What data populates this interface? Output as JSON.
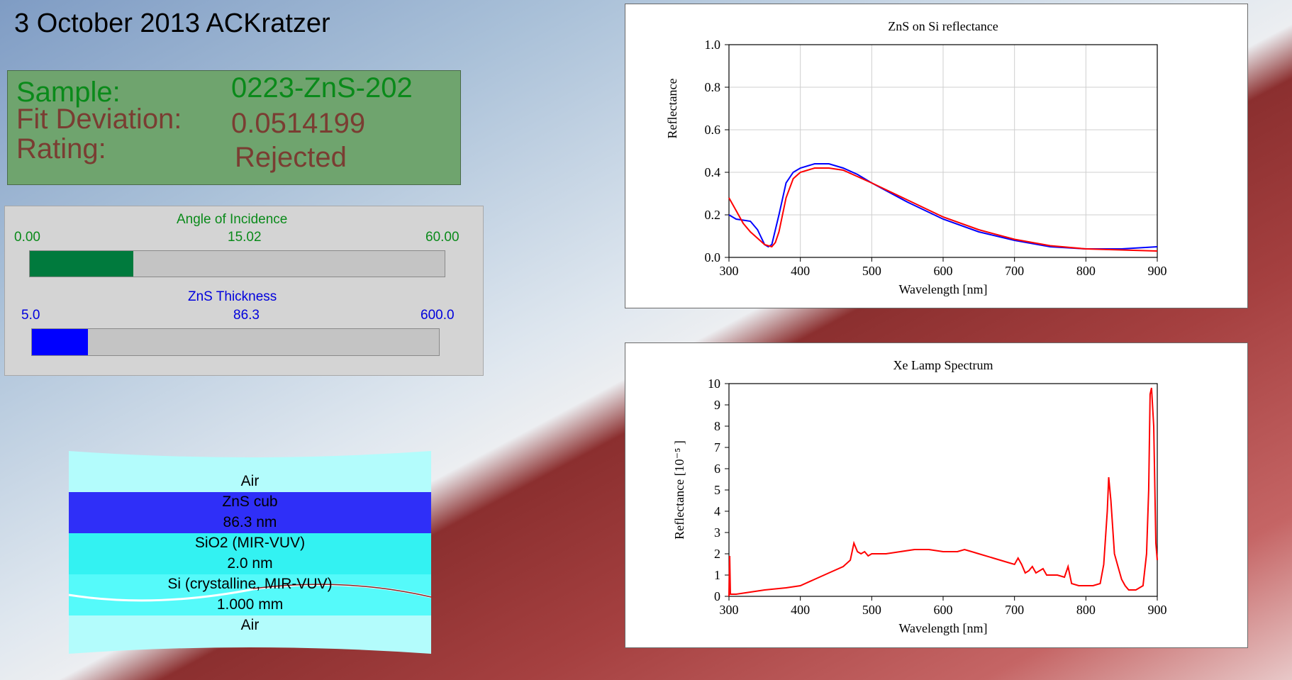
{
  "header": {
    "title": "3 October 2013 ACKratzer"
  },
  "info": {
    "sample_label": "Sample:",
    "sample_value": "0223-ZnS-202",
    "fit_label": "Fit Deviation:",
    "fit_value": "0.0514199",
    "rating_label": "Rating:",
    "rating_value": "Rejected"
  },
  "sliders": {
    "angle": {
      "title": "Angle of Incidence",
      "min": "0.00",
      "value": "15.02",
      "max": "60.00",
      "fraction": 0.25,
      "color": "#007a3d"
    },
    "thickness": {
      "title": "ZnS Thickness",
      "min": "5.0",
      "value": "86.3",
      "max": "600.0",
      "fraction": 0.137,
      "color": "#0000ff"
    }
  },
  "stack": {
    "layers": [
      {
        "label": "Air",
        "color": "#b3fcfc"
      },
      {
        "label": "ZnS cub",
        "sub": "86.3 nm",
        "color": "#2f2ff8"
      },
      {
        "label": "SiO2 (MIR-VUV)",
        "sub": "2.0 nm",
        "color": "#33f2f2"
      },
      {
        "label": "Si (crystalline, MIR-VUV)",
        "sub": "1.000 mm",
        "color": "#55fafa"
      },
      {
        "label": "Air",
        "color": "#b3fcfc"
      }
    ]
  },
  "chart_data": [
    {
      "type": "line",
      "title": "ZnS on Si reflectance",
      "xlabel": "Wavelength [nm]",
      "ylabel": "Reflectance",
      "xlim": [
        300,
        900
      ],
      "ylim": [
        0,
        1.0
      ],
      "xticks": [
        "300",
        "400",
        "500",
        "600",
        "700",
        "800",
        "900"
      ],
      "yticks": [
        "0.0",
        "0.2",
        "0.4",
        "0.6",
        "0.8",
        "1.0"
      ],
      "grid": true,
      "series": [
        {
          "color": "#0000ff",
          "x": [
            300,
            310,
            320,
            330,
            340,
            350,
            355,
            360,
            370,
            380,
            390,
            400,
            420,
            440,
            460,
            480,
            500,
            550,
            600,
            650,
            700,
            750,
            800,
            850,
            900
          ],
          "y": [
            0.2,
            0.18,
            0.175,
            0.17,
            0.13,
            0.06,
            0.05,
            0.06,
            0.2,
            0.35,
            0.4,
            0.42,
            0.44,
            0.44,
            0.42,
            0.39,
            0.35,
            0.26,
            0.18,
            0.12,
            0.08,
            0.05,
            0.04,
            0.04,
            0.05
          ]
        },
        {
          "color": "#ff0000",
          "x": [
            300,
            310,
            320,
            330,
            340,
            350,
            360,
            365,
            370,
            380,
            390,
            400,
            420,
            440,
            460,
            480,
            500,
            550,
            600,
            650,
            700,
            750,
            800,
            850,
            900
          ],
          "y": [
            0.28,
            0.22,
            0.16,
            0.12,
            0.09,
            0.06,
            0.05,
            0.07,
            0.12,
            0.28,
            0.37,
            0.4,
            0.42,
            0.42,
            0.41,
            0.38,
            0.35,
            0.27,
            0.19,
            0.13,
            0.085,
            0.055,
            0.04,
            0.035,
            0.03
          ]
        }
      ]
    },
    {
      "type": "line",
      "title": "Xe Lamp Spectrum",
      "xlabel": "Wavelength [nm]",
      "ylabel": "Reflectance [10⁻⁵ ]",
      "xlim": [
        300,
        900
      ],
      "ylim": [
        0,
        10
      ],
      "xticks": [
        "300",
        "400",
        "500",
        "600",
        "700",
        "800",
        "900"
      ],
      "yticks": [
        "0",
        "1",
        "2",
        "3",
        "4",
        "5",
        "6",
        "7",
        "8",
        "9",
        "10"
      ],
      "grid": false,
      "series": [
        {
          "color": "#ff0000",
          "x": [
            300,
            301,
            302,
            310,
            330,
            350,
            380,
            400,
            420,
            440,
            460,
            470,
            475,
            480,
            485,
            490,
            495,
            500,
            520,
            540,
            560,
            580,
            600,
            620,
            630,
            640,
            650,
            670,
            690,
            700,
            705,
            710,
            715,
            720,
            725,
            730,
            740,
            745,
            750,
            760,
            770,
            775,
            780,
            790,
            800,
            810,
            820,
            825,
            830,
            832,
            835,
            840,
            845,
            850,
            855,
            860,
            870,
            880,
            885,
            888,
            890,
            892,
            895,
            898,
            900
          ],
          "y": [
            0,
            1.9,
            0.1,
            0.1,
            0.2,
            0.3,
            0.4,
            0.5,
            0.8,
            1.1,
            1.4,
            1.7,
            2.5,
            2.1,
            2.0,
            2.1,
            1.9,
            2.0,
            2.0,
            2.1,
            2.2,
            2.2,
            2.1,
            2.1,
            2.2,
            2.1,
            2.0,
            1.8,
            1.6,
            1.5,
            1.8,
            1.5,
            1.1,
            1.2,
            1.4,
            1.1,
            1.3,
            1.0,
            1.0,
            1.0,
            0.9,
            1.4,
            0.6,
            0.5,
            0.5,
            0.5,
            0.6,
            1.5,
            4.0,
            5.6,
            4.5,
            2.0,
            1.4,
            0.8,
            0.5,
            0.3,
            0.3,
            0.5,
            2.0,
            5.0,
            9.5,
            9.8,
            8.0,
            2.5,
            1.7
          ]
        }
      ]
    }
  ]
}
